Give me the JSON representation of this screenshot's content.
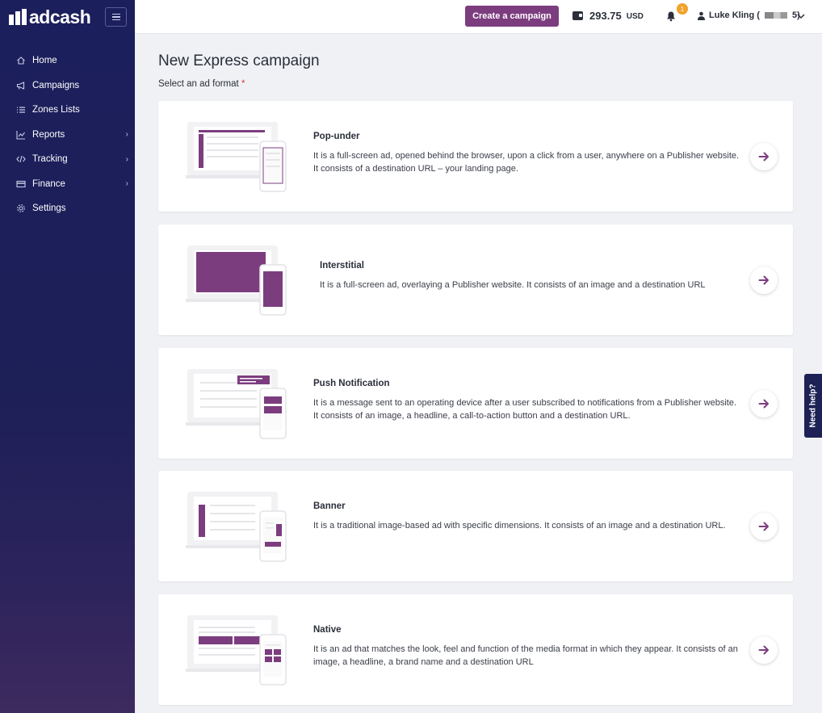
{
  "brand": {
    "logo_text": "adcash"
  },
  "sidebar": {
    "items": [
      {
        "label": "Home",
        "icon": "home-icon",
        "has_submenu": false
      },
      {
        "label": "Campaigns",
        "icon": "megaphone-icon",
        "has_submenu": false
      },
      {
        "label": "Zones Lists",
        "icon": "list-icon",
        "has_submenu": false
      },
      {
        "label": "Reports",
        "icon": "chart-icon",
        "has_submenu": true
      },
      {
        "label": "Tracking",
        "icon": "code-icon",
        "has_submenu": true
      },
      {
        "label": "Finance",
        "icon": "card-icon",
        "has_submenu": true
      },
      {
        "label": "Settings",
        "icon": "gear-icon",
        "has_submenu": false
      }
    ]
  },
  "header": {
    "create_button": "Create a campaign",
    "balance_amount": "293.75",
    "balance_currency": "USD",
    "notification_count": "1",
    "user_name": "Luke Kling (",
    "user_suffix": "5)"
  },
  "main": {
    "title": "New Express campaign",
    "subtitle": "Select an ad format",
    "required_mark": "*",
    "formats": [
      {
        "title": "Pop-under",
        "description": "It is a full-screen ad, opened behind the browser, upon a click from a user, anywhere on a Publisher website. It consists of a destination URL – your landing page."
      },
      {
        "title": "Interstitial",
        "description": "It is a full-screen ad, overlaying a Publisher website. It consists of an image and a destination URL"
      },
      {
        "title": "Push Notification",
        "description": "It is a message sent to an operating device after a user subscribed to notifications from a Publisher website. It consists of an image, a headline, a call-to-action button and a destination URL."
      },
      {
        "title": "Banner",
        "description": "It is a traditional image-based ad with specific dimensions. It consists of an image and a destination URL."
      },
      {
        "title": "Native",
        "description": "It is an ad that matches the look, feel and function of the media format in which they appear. It consists of an image, a headline, a brand name and a destination URL"
      }
    ]
  },
  "help_tab": "Need help?",
  "colors": {
    "brand_purple": "#7c3d7f",
    "sidebar_navy": "#1b1f5c",
    "badge_orange": "#f2a22c"
  }
}
